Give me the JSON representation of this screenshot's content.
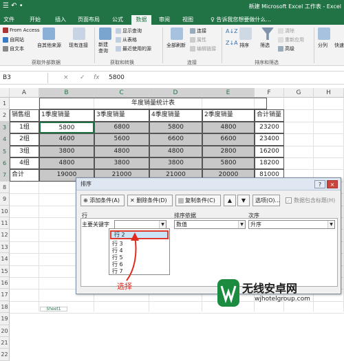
{
  "titlebar": {
    "quick_access": "☰ ↶ •",
    "title": "新建 Microsoft Excel 工作表 - Excel"
  },
  "tabs": [
    "文件",
    "开始",
    "插入",
    "页面布局",
    "公式",
    "数据",
    "审阅",
    "视图"
  ],
  "tell_me": "♀ 告诉我您想要做什么...",
  "ribbon": {
    "access": "From Access",
    "web": "自网站",
    "text": "自文本",
    "other_sources": "自其他来源",
    "existing_conn": "现有连接",
    "group_get_external": "获取外部数据",
    "new_query": "新建\n查询",
    "show_query": "显示查询",
    "from_table": "从表格",
    "recent_sources": "最近使用的源",
    "group_get_transform": "获取和转换",
    "refresh_all": "全部刷新",
    "connections": "连接",
    "properties": "属性",
    "edit_links": "编辑链接",
    "group_connections": "连接",
    "sort": "排序",
    "filter": "筛选",
    "clear": "清除",
    "reapply": "重新应用",
    "advanced": "高级",
    "group_sort_filter": "排序和筛选",
    "split": "分列",
    "quick": "快速"
  },
  "formula": {
    "name_box": "B3",
    "cancel": "×",
    "enter": "✓",
    "fx": "fx",
    "value": "5800"
  },
  "columns": [
    "A",
    "B",
    "C",
    "D",
    "E",
    "F",
    "G",
    "H"
  ],
  "rows": [
    "1",
    "2",
    "3",
    "4",
    "5",
    "6",
    "7",
    "8",
    "9",
    "10",
    "11",
    "12",
    "13",
    "14",
    "15",
    "16",
    "17",
    "18",
    "19",
    "20",
    "21",
    "22"
  ],
  "sheet": {
    "title": "年度销量统计表",
    "headers": [
      "销售组",
      "1季度销量",
      "3季度销量",
      "4季度销量",
      "2季度销量",
      "合计销量"
    ],
    "rows": [
      [
        "1组",
        "5800",
        "6800",
        "5800",
        "4800",
        "23200"
      ],
      [
        "2组",
        "4600",
        "5600",
        "6600",
        "6600",
        "23400"
      ],
      [
        "3组",
        "3800",
        "4800",
        "4800",
        "2800",
        "16200"
      ],
      [
        "4组",
        "4800",
        "3800",
        "3800",
        "5800",
        "18200"
      ],
      [
        "合计",
        "19000",
        "21000",
        "21000",
        "20000",
        "81000"
      ]
    ]
  },
  "dialog": {
    "title": "排序",
    "help": "?",
    "close": "×",
    "add_level": "⊕ 添加条件(A)",
    "delete_level": "✕ 删除条件(D)",
    "copy_level": "复制条件(C)",
    "move_up": "▲",
    "move_down": "▼",
    "options": "选项(O)...",
    "has_headers": "数据包含标题(H)",
    "col_row": "行",
    "col_sort_on": "排序依据",
    "col_order": "次序",
    "primary_key": "主要关键字",
    "sort_on_value": "数值",
    "order_value": "升序",
    "dropdown_items": [
      "行 2",
      "行 3",
      "行 4",
      "行 5",
      "行 6",
      "行 7"
    ],
    "selected_item": "行 2"
  },
  "annotation": "选择",
  "sheet_tab": "Sheet1",
  "watermark": {
    "title": "无线安卓网",
    "url": "wjhotelgroup.com"
  },
  "colors": {
    "excel_green": "#217346",
    "red": "#e02a1e",
    "selected_fill": "#c8c8c8",
    "highlight": "#cce4f7"
  }
}
